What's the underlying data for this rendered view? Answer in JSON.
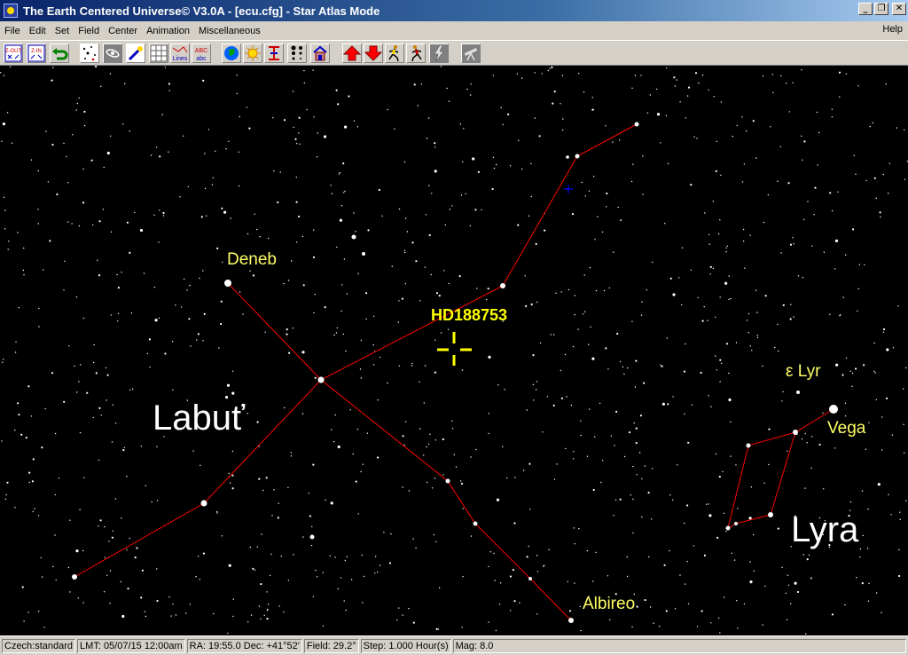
{
  "window": {
    "title": "The Earth Centered Universe© V3.0A - [ecu.cfg] - Star Atlas Mode",
    "controls": [
      "_",
      "❐",
      "✕"
    ]
  },
  "menu": {
    "items": [
      "File",
      "Edit",
      "Set",
      "Field",
      "Center",
      "Animation",
      "Miscellaneous"
    ],
    "help": "Help"
  },
  "toolbar": {
    "zoom_out": "Z-OUT",
    "zoom_in": "Z-IN",
    "lines": "Lines",
    "labels": "ABC abc",
    "buttons": [
      {
        "name": "zoom-out",
        "label": "Z-OUT",
        "icon": "zoom-out-icon"
      },
      {
        "name": "zoom-in",
        "label": "Z-IN",
        "icon": "zoom-in-icon"
      },
      {
        "name": "undo",
        "label": "",
        "icon": "undo-arrow-icon"
      },
      {
        "name": "stars",
        "label": "",
        "icon": "stars-icon"
      },
      {
        "name": "galaxy",
        "label": "",
        "icon": "galaxy-icon"
      },
      {
        "name": "comet",
        "label": "",
        "icon": "comet-icon"
      },
      {
        "name": "grid",
        "label": "",
        "icon": "grid-icon"
      },
      {
        "name": "lines",
        "label": "Lines",
        "icon": "constellation-lines-icon"
      },
      {
        "name": "labels",
        "label": "ABC abc",
        "icon": "labels-icon"
      },
      {
        "name": "globe",
        "label": "",
        "icon": "globe-icon"
      },
      {
        "name": "sun",
        "label": "",
        "icon": "sun-icon"
      },
      {
        "name": "meridian",
        "label": "",
        "icon": "meridian-icon"
      },
      {
        "name": "magnitude",
        "label": "",
        "icon": "magnitude-dots-icon"
      },
      {
        "name": "house",
        "label": "",
        "icon": "house-icon"
      },
      {
        "name": "step-forward",
        "label": "",
        "icon": "red-arrow-up-icon"
      },
      {
        "name": "step-back",
        "label": "",
        "icon": "red-arrow-down-icon"
      },
      {
        "name": "run-forward",
        "label": "",
        "icon": "runner-icon"
      },
      {
        "name": "run-back",
        "label": "",
        "icon": "runner-back-icon"
      },
      {
        "name": "stop",
        "label": "",
        "icon": "lightning-icon"
      },
      {
        "name": "telescope",
        "label": "",
        "icon": "telescope-icon"
      }
    ]
  },
  "sky": {
    "labels": {
      "deneb": "Deneb",
      "target": "HD188753",
      "labut": "Labuť",
      "epsilon_lyr": "ε Lyr",
      "vega": "Vega",
      "lyra": "Lyra",
      "albireo": "Albireo"
    },
    "colors": {
      "background": "#000000",
      "constellation_lines": "#ff0000",
      "labels": "#ffff66",
      "constellation_names": "#ffffff",
      "target_marker": "#ffff00"
    }
  },
  "status": {
    "profile": "Czech:standard",
    "lmt": "LMT: 05/07/15 12:00am",
    "coords": "RA: 19:55.0 Dec: +41°52'",
    "field": "Field: 29.2°",
    "step": "Step: 1.000 Hour(s)",
    "mag": "Mag: 8.0"
  }
}
